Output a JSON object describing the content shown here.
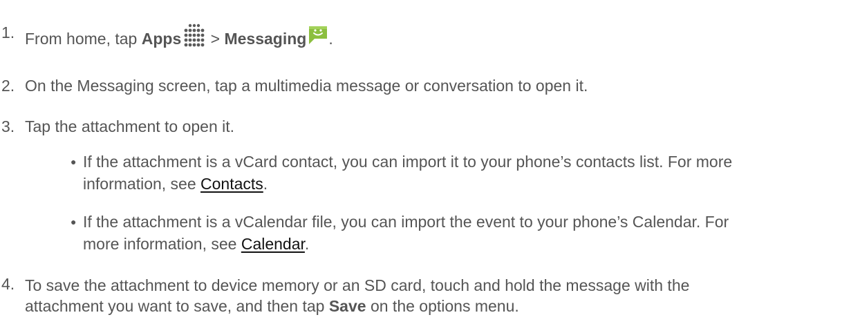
{
  "steps": {
    "s1": {
      "num": "1.",
      "pre": "From home, tap ",
      "apps": "Apps",
      "sep": " > ",
      "messaging": "Messaging",
      "post": "."
    },
    "s2": {
      "num": "2.",
      "text": "On the Messaging screen, tap a multimedia message or conversation to open it."
    },
    "s3": {
      "num": "3.",
      "text": "Tap the attachment to open it."
    },
    "b1": {
      "line1": "If the attachment is a vCard contact, you can import it to your phone’s contacts list. For more",
      "pre2": "information, see ",
      "link": "Contacts",
      "post2": "."
    },
    "b2": {
      "line1": "If the attachment is a vCalendar file, you can import the event to your phone’s Calendar. For",
      "pre2": "more information, see ",
      "link": "Calendar",
      "post2": "."
    },
    "s4": {
      "num": "4.",
      "line1": "To save the attachment to device memory or an SD card, touch and hold the message with the",
      "pre2": "attachment you want to save, and then tap ",
      "save": "Save",
      "post2": " on the options menu."
    }
  },
  "icons": {
    "apps": "apps-grid-icon",
    "messaging": "messaging-app-icon",
    "bullet": "bullet-dot-icon"
  },
  "colors": {
    "text": "#555555",
    "link": "#111111",
    "messaging_icon": "#8cbf3f"
  }
}
